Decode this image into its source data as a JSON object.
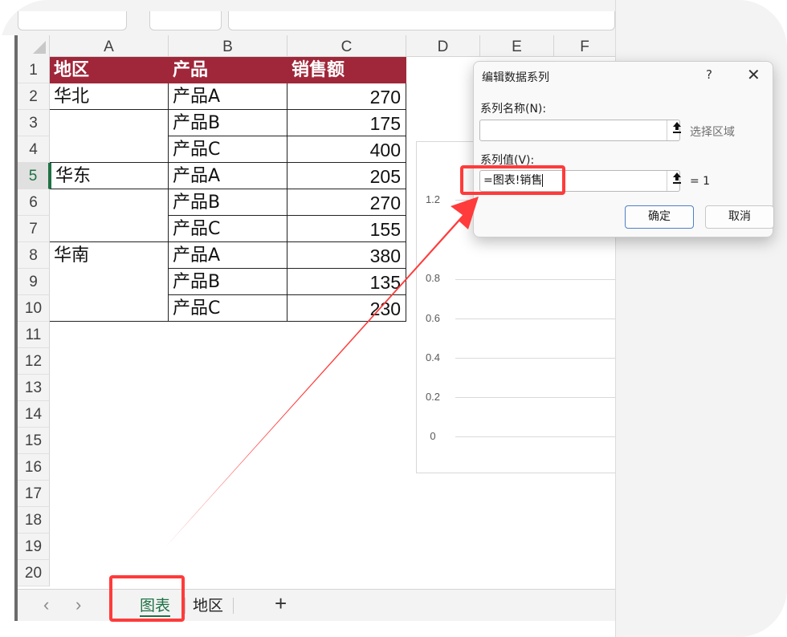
{
  "columns": [
    "A",
    "B",
    "C",
    "D",
    "E",
    "F"
  ],
  "rows": [
    "1",
    "2",
    "3",
    "4",
    "5",
    "6",
    "7",
    "8",
    "9",
    "10",
    "11",
    "12",
    "13",
    "14",
    "15",
    "16",
    "17",
    "18",
    "19",
    "20"
  ],
  "active_row": "5",
  "table": {
    "header": [
      "地区",
      "产品",
      "销售额"
    ],
    "data": [
      [
        "华北",
        "产品A",
        "270"
      ],
      [
        "",
        "产品B",
        "175"
      ],
      [
        "",
        "产品C",
        "400"
      ],
      [
        "华东",
        "产品A",
        "205"
      ],
      [
        "",
        "产品B",
        "270"
      ],
      [
        "",
        "产品C",
        "155"
      ],
      [
        "华南",
        "产品A",
        "380"
      ],
      [
        "",
        "产品B",
        "135"
      ],
      [
        "",
        "产品C",
        "230"
      ]
    ],
    "header_color": "#a0273a"
  },
  "chart": {
    "y_ticks": [
      "1.2",
      "0.8",
      "0.6",
      "0.4",
      "0.2",
      "0"
    ]
  },
  "dialog": {
    "title": "编辑数据系列",
    "help": "?",
    "close": "✕",
    "series_name_label": "系列名称(N):",
    "series_name_value": "",
    "select_range": "选择区域",
    "series_values_label": "系列值(V):",
    "series_values_value": "=图表!销售",
    "series_values_result": "= 1",
    "ok": "确定",
    "cancel": "取消",
    "collapse_icon": "collapse-range-icon"
  },
  "sheet_tabs": {
    "prev": "‹",
    "next": "›",
    "tabs": [
      "图表",
      "地区"
    ],
    "active": "图表",
    "add": "+"
  },
  "annotation_color": "#ff3b3b"
}
